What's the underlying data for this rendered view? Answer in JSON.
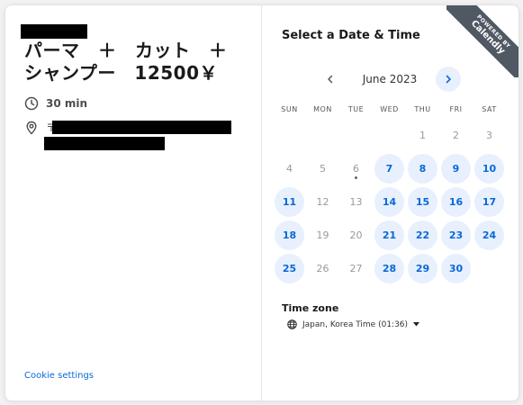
{
  "event": {
    "title": "パーマ　＋　カット　＋\nシャンプー　12500￥",
    "duration": "30 min",
    "postal_mark": "〒"
  },
  "footer": {
    "cookie_settings": "Cookie settings"
  },
  "badge": {
    "line1": "POWERED BY",
    "line2": "Calendly"
  },
  "calendar": {
    "heading": "Select a Date & Time",
    "month": "June 2023",
    "weekdays": [
      "SUN",
      "MON",
      "TUE",
      "WED",
      "THU",
      "FRI",
      "SAT"
    ],
    "weeks": [
      [
        "",
        "",
        "",
        "",
        "1",
        "2",
        "3"
      ],
      [
        "4",
        "5",
        "6",
        "7",
        "8",
        "9",
        "10"
      ],
      [
        "11",
        "12",
        "13",
        "14",
        "15",
        "16",
        "17"
      ],
      [
        "18",
        "19",
        "20",
        "21",
        "22",
        "23",
        "24"
      ],
      [
        "25",
        "26",
        "27",
        "28",
        "29",
        "30",
        ""
      ]
    ],
    "available_days": [
      "7",
      "8",
      "9",
      "10",
      "11",
      "14",
      "15",
      "16",
      "17",
      "18",
      "21",
      "22",
      "23",
      "24",
      "25",
      "28",
      "29",
      "30"
    ],
    "today": "6"
  },
  "timezone": {
    "label": "Time zone",
    "value": "Japan, Korea Time (01:36)"
  },
  "colors": {
    "accent": "#0a69d6",
    "accent_bg": "#e8f0fd",
    "badge_bg": "#505864"
  },
  "icons": {
    "duration": "clock-icon",
    "location": "location-pin-icon",
    "prev": "chevron-left-icon",
    "next": "chevron-right-icon",
    "timezone": "globe-icon",
    "dropdown": "caret-down-icon"
  }
}
